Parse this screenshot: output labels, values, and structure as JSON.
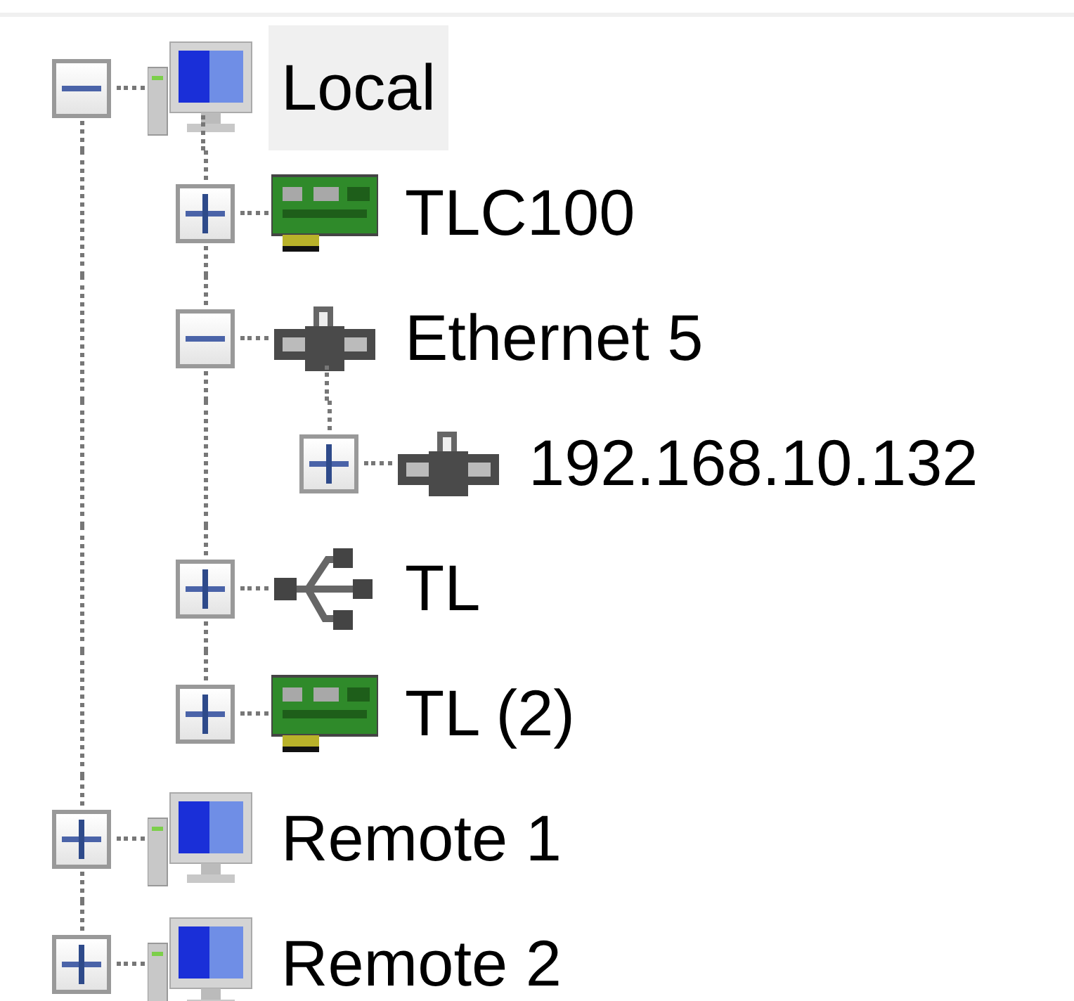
{
  "tree": [
    {
      "label": "Local",
      "kind": "computer",
      "expanded": true,
      "selected": true,
      "children": [
        {
          "label": "TLC100",
          "kind": "card",
          "expanded": false,
          "selected": false
        },
        {
          "label": "Ethernet 5",
          "kind": "network",
          "expanded": true,
          "selected": false,
          "children": [
            {
              "label": "192.168.10.132",
              "kind": "network",
              "expanded": false,
              "selected": false
            }
          ]
        },
        {
          "label": "TL",
          "kind": "usb",
          "expanded": false,
          "selected": false
        },
        {
          "label": "TL (2)",
          "kind": "card",
          "expanded": false,
          "selected": false
        }
      ]
    },
    {
      "label": "Remote 1",
      "kind": "computer",
      "expanded": false,
      "selected": false
    },
    {
      "label": "Remote 2",
      "kind": "computer",
      "expanded": false,
      "selected": false
    }
  ]
}
